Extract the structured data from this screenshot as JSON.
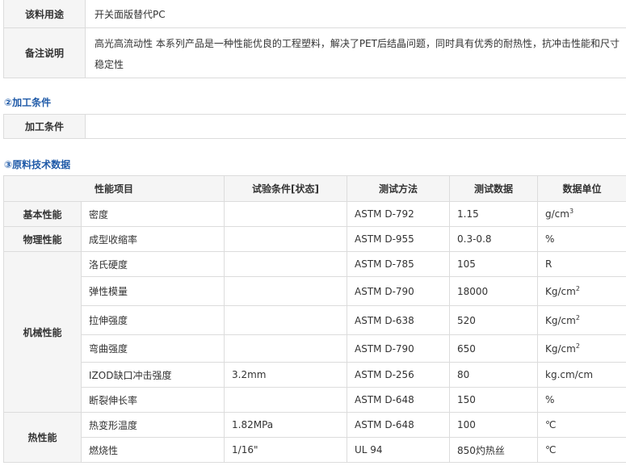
{
  "info": {
    "usage_label": "该料用途",
    "usage_value": "开关面版替代PC",
    "note_label": "备注说明",
    "note_value": "高光高流动性 本系列产品是一种性能优良的工程塑料，解决了PET后结晶问题，同时具有优秀的耐热性，抗冲击性能和尺寸稳定性"
  },
  "process": {
    "title": "②加工条件",
    "label": "加工条件",
    "value": ""
  },
  "tech": {
    "title": "③原料技术数据",
    "headers": [
      "性能项目",
      "试验条件[状态]",
      "测试方法",
      "测试数据",
      "数据单位"
    ],
    "categories": [
      "基本性能",
      "物理性能",
      "机械性能",
      "热性能"
    ],
    "rows": [
      {
        "item": "密度",
        "condition": "",
        "method": "ASTM D-792",
        "value": "1.15",
        "unit": "g/cm",
        "sup": "3"
      },
      {
        "item": "成型收缩率",
        "condition": "",
        "method": "ASTM D-955",
        "value": "0.3-0.8",
        "unit": "%",
        "sup": ""
      },
      {
        "item": "洛氏硬度",
        "condition": "",
        "method": "ASTM D-785",
        "value": "105",
        "unit": "R",
        "sup": ""
      },
      {
        "item": "弹性模量",
        "condition": "",
        "method": "ASTM D-790",
        "value": "18000",
        "unit": "Kg/cm",
        "sup": "2"
      },
      {
        "item": "拉伸强度",
        "condition": "",
        "method": "ASTM D-638",
        "value": "520",
        "unit": "Kg/cm",
        "sup": "2"
      },
      {
        "item": "弯曲强度",
        "condition": "",
        "method": "ASTM D-790",
        "value": "650",
        "unit": "Kg/cm",
        "sup": "2"
      },
      {
        "item": "IZOD缺口冲击强度",
        "condition": "3.2mm",
        "method": "ASTM D-256",
        "value": "80",
        "unit": "kg.cm/cm",
        "sup": ""
      },
      {
        "item": "断裂伸长率",
        "condition": "",
        "method": "ASTM D-648",
        "value": "150",
        "unit": "%",
        "sup": ""
      },
      {
        "item": "热变形温度",
        "condition": "1.82MPa",
        "method": "ASTM D-648",
        "value": "100",
        "unit": "℃",
        "sup": ""
      },
      {
        "item": "燃烧性",
        "condition": "1/16\"",
        "method": "UL 94",
        "value": "850灼热丝",
        "unit": "℃",
        "sup": ""
      }
    ]
  }
}
